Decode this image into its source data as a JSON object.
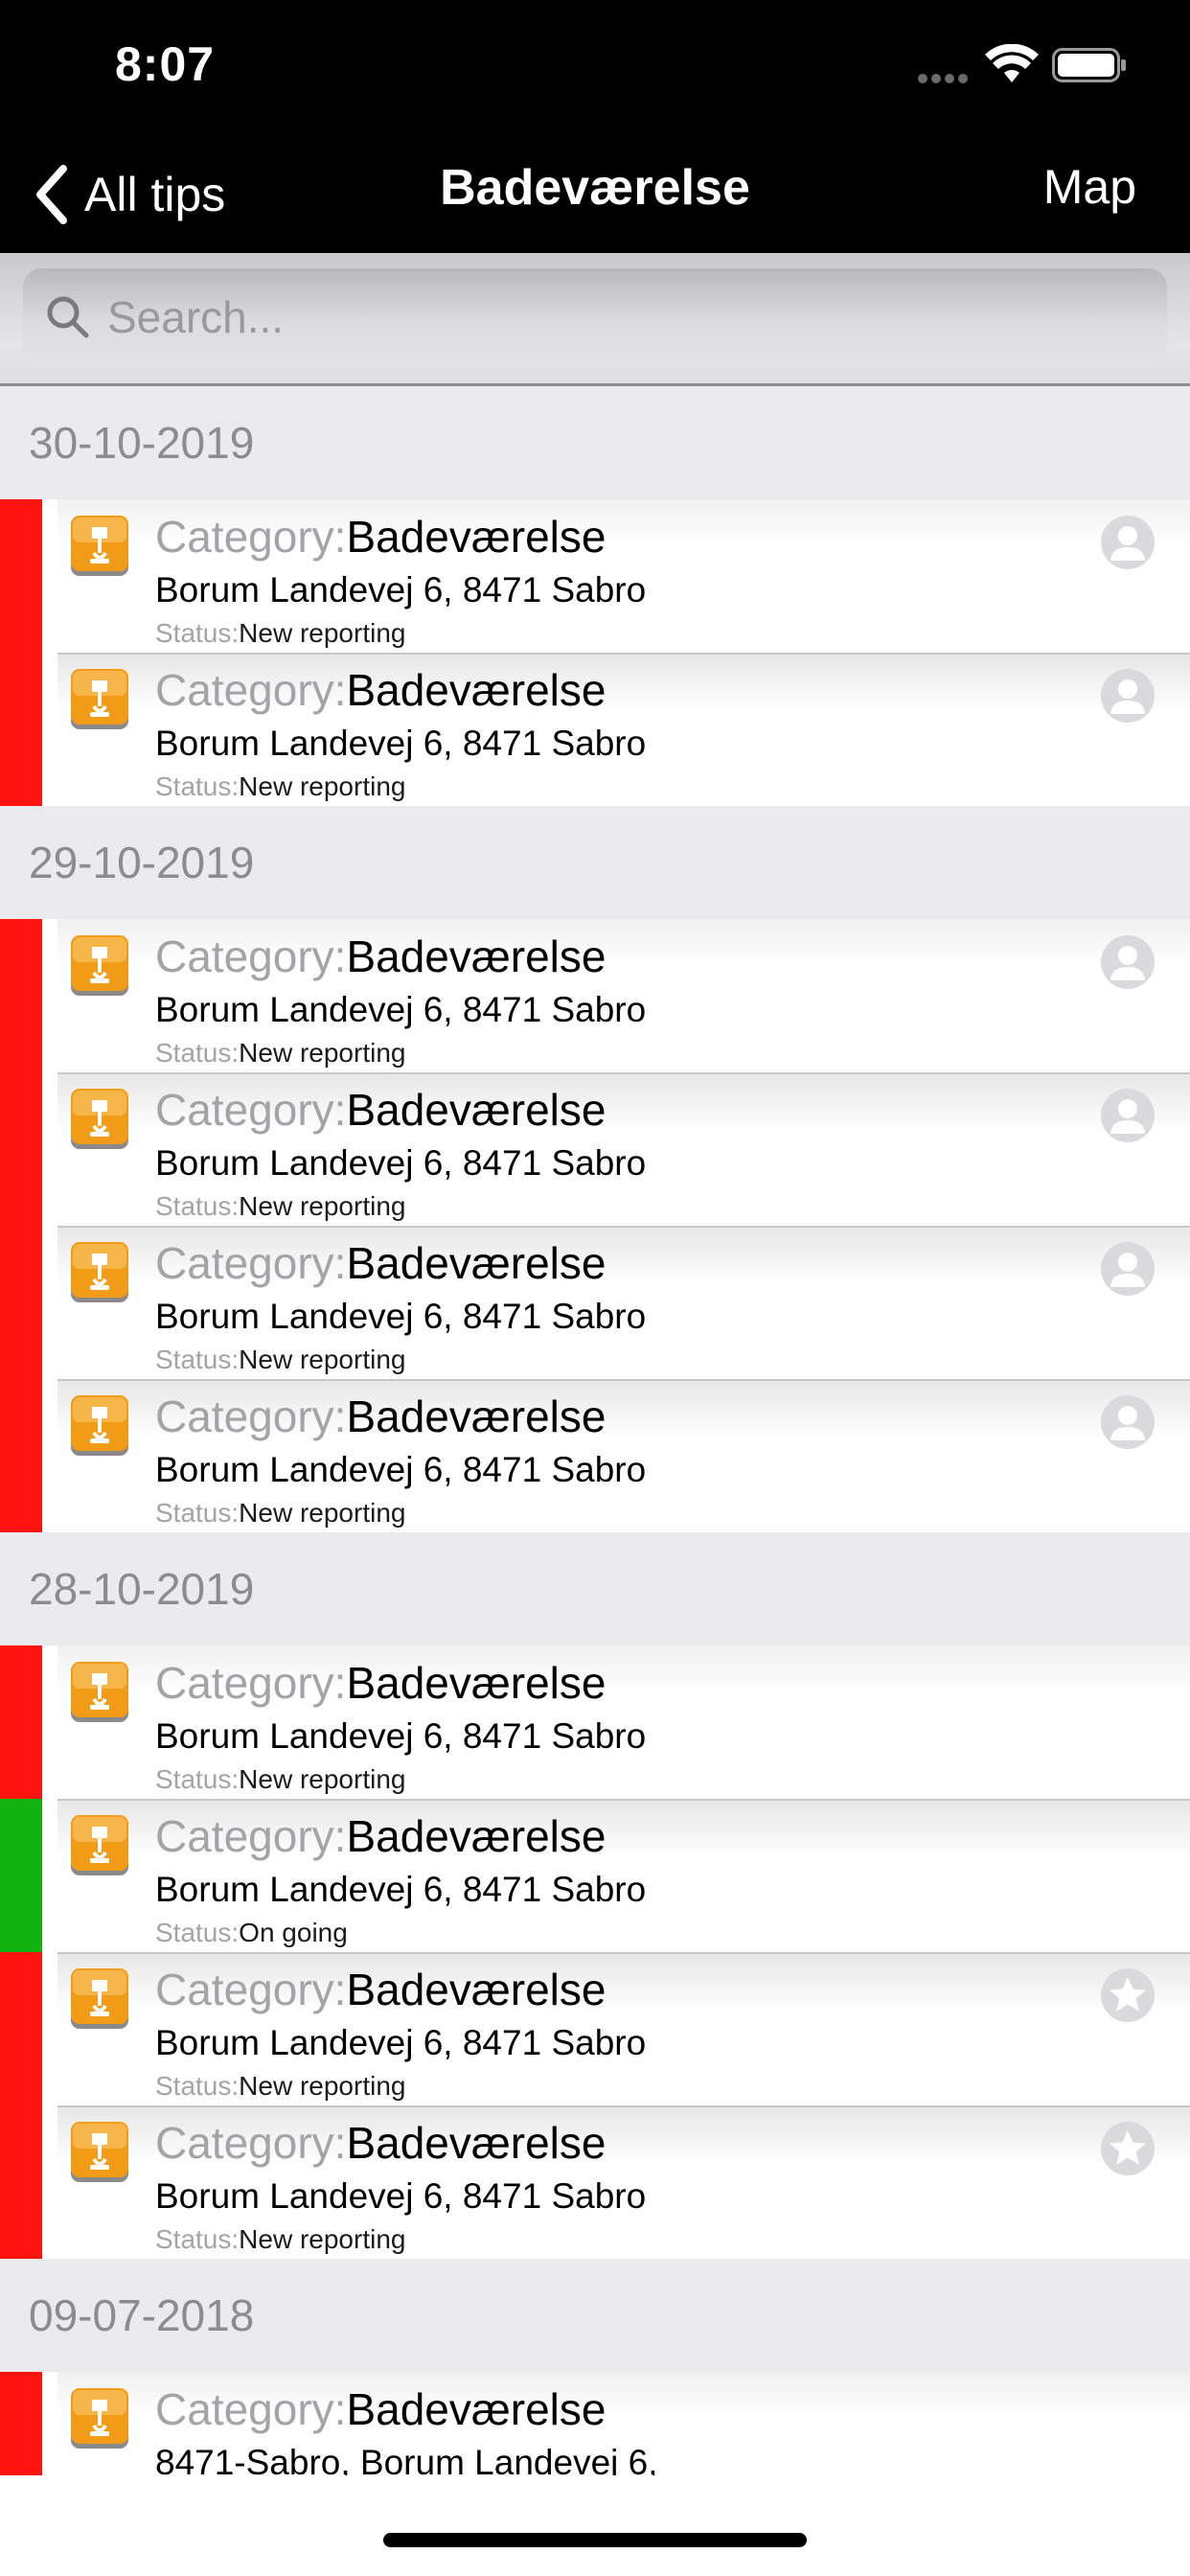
{
  "status_bar": {
    "time": "8:07"
  },
  "nav": {
    "back_label": "All tips",
    "title": "Badeværelse",
    "map_label": "Map"
  },
  "search": {
    "placeholder": "Search..."
  },
  "labels": {
    "category": "Category:",
    "status": "Status:"
  },
  "colors": {
    "red": "#ff130f",
    "green": "#10b310",
    "accent": "#f29b16"
  },
  "sections": [
    {
      "date": "30-10-2019",
      "items": [
        {
          "category": "Badeværelse",
          "address": "Borum Landevej 6, 8471 Sabro",
          "status": "New reporting",
          "bar": "red",
          "badge": "person-icon"
        },
        {
          "category": "Badeværelse",
          "address": "Borum Landevej 6, 8471 Sabro",
          "status": "New reporting",
          "bar": "red",
          "badge": "person-icon"
        }
      ]
    },
    {
      "date": "29-10-2019",
      "items": [
        {
          "category": "Badeværelse",
          "address": "Borum Landevej 6, 8471 Sabro",
          "status": "New reporting",
          "bar": "red",
          "badge": "person-icon"
        },
        {
          "category": "Badeværelse",
          "address": "Borum Landevej 6, 8471 Sabro",
          "status": "New reporting",
          "bar": "red",
          "badge": "person-icon"
        },
        {
          "category": "Badeværelse",
          "address": "Borum Landevej 6, 8471 Sabro",
          "status": "New reporting",
          "bar": "red",
          "badge": "person-icon"
        },
        {
          "category": "Badeværelse",
          "address": "Borum Landevej 6, 8471 Sabro",
          "status": "New reporting",
          "bar": "red",
          "badge": "person-icon"
        }
      ]
    },
    {
      "date": "28-10-2019",
      "items": [
        {
          "category": "Badeværelse",
          "address": "Borum Landevej 6, 8471 Sabro",
          "status": "New reporting",
          "bar": "red",
          "badge": ""
        },
        {
          "category": "Badeværelse",
          "address": "Borum Landevej 6, 8471 Sabro",
          "status": "On going",
          "bar": "green",
          "badge": ""
        },
        {
          "category": "Badeværelse",
          "address": "Borum Landevej 6, 8471 Sabro",
          "status": "New reporting",
          "bar": "red",
          "badge": "star-icon"
        },
        {
          "category": "Badeværelse",
          "address": "Borum Landevej 6, 8471 Sabro",
          "status": "New reporting",
          "bar": "red",
          "badge": "star-icon"
        }
      ]
    },
    {
      "date": "09-07-2018",
      "items": [
        {
          "category": "Badeværelse",
          "address": "8471-Sabro, Borum Landevej 6,",
          "status": "",
          "bar": "red",
          "badge": ""
        }
      ]
    }
  ]
}
